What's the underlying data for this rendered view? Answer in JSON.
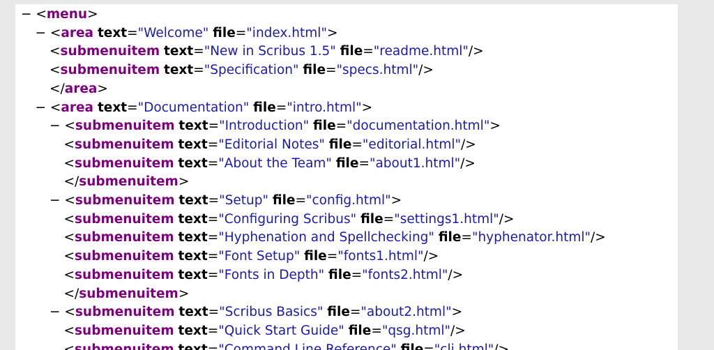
{
  "lines": [
    {
      "indent": 0,
      "toggle": "−",
      "kind": "open",
      "tag": "menu",
      "attrs": []
    },
    {
      "indent": 1,
      "toggle": "−",
      "kind": "open",
      "tag": "area",
      "attrs": [
        {
          "name": "text",
          "value": "Welcome"
        },
        {
          "name": "file",
          "value": "index.html"
        }
      ]
    },
    {
      "indent": 2,
      "toggle": "",
      "kind": "self",
      "tag": "submenuitem",
      "attrs": [
        {
          "name": "text",
          "value": "New in Scribus 1.5"
        },
        {
          "name": "file",
          "value": "readme.html"
        }
      ]
    },
    {
      "indent": 2,
      "toggle": "",
      "kind": "self",
      "tag": "submenuitem",
      "attrs": [
        {
          "name": "text",
          "value": "Specification"
        },
        {
          "name": "file",
          "value": "specs.html"
        }
      ]
    },
    {
      "indent": 2,
      "toggle": "",
      "kind": "close",
      "tag": "area",
      "attrs": []
    },
    {
      "indent": 1,
      "toggle": "−",
      "kind": "open",
      "tag": "area",
      "attrs": [
        {
          "name": "text",
          "value": "Documentation"
        },
        {
          "name": "file",
          "value": "intro.html"
        }
      ]
    },
    {
      "indent": 2,
      "toggle": "−",
      "kind": "open",
      "tag": "submenuitem",
      "attrs": [
        {
          "name": "text",
          "value": "Introduction"
        },
        {
          "name": "file",
          "value": "documentation.html"
        }
      ]
    },
    {
      "indent": 3,
      "toggle": "",
      "kind": "self",
      "tag": "submenuitem",
      "attrs": [
        {
          "name": "text",
          "value": "Editorial Notes"
        },
        {
          "name": "file",
          "value": "editorial.html"
        }
      ]
    },
    {
      "indent": 3,
      "toggle": "",
      "kind": "self",
      "tag": "submenuitem",
      "attrs": [
        {
          "name": "text",
          "value": "About the Team"
        },
        {
          "name": "file",
          "value": "about1.html"
        }
      ]
    },
    {
      "indent": 3,
      "toggle": "",
      "kind": "close",
      "tag": "submenuitem",
      "attrs": []
    },
    {
      "indent": 2,
      "toggle": "−",
      "kind": "open",
      "tag": "submenuitem",
      "attrs": [
        {
          "name": "text",
          "value": "Setup"
        },
        {
          "name": "file",
          "value": "config.html"
        }
      ]
    },
    {
      "indent": 3,
      "toggle": "",
      "kind": "self",
      "tag": "submenuitem",
      "attrs": [
        {
          "name": "text",
          "value": "Configuring Scribus"
        },
        {
          "name": "file",
          "value": "settings1.html"
        }
      ]
    },
    {
      "indent": 3,
      "toggle": "",
      "kind": "self",
      "tag": "submenuitem",
      "attrs": [
        {
          "name": "text",
          "value": "Hyphenation and Spellchecking"
        },
        {
          "name": "file",
          "value": "hyphenator.html"
        }
      ]
    },
    {
      "indent": 3,
      "toggle": "",
      "kind": "self",
      "tag": "submenuitem",
      "attrs": [
        {
          "name": "text",
          "value": "Font Setup"
        },
        {
          "name": "file",
          "value": "fonts1.html"
        }
      ]
    },
    {
      "indent": 3,
      "toggle": "",
      "kind": "self",
      "tag": "submenuitem",
      "attrs": [
        {
          "name": "text",
          "value": "Fonts in Depth"
        },
        {
          "name": "file",
          "value": "fonts2.html"
        }
      ]
    },
    {
      "indent": 3,
      "toggle": "",
      "kind": "close",
      "tag": "submenuitem",
      "attrs": []
    },
    {
      "indent": 2,
      "toggle": "−",
      "kind": "open",
      "tag": "submenuitem",
      "attrs": [
        {
          "name": "text",
          "value": "Scribus Basics"
        },
        {
          "name": "file",
          "value": "about2.html"
        }
      ]
    },
    {
      "indent": 3,
      "toggle": "",
      "kind": "self",
      "tag": "submenuitem",
      "attrs": [
        {
          "name": "text",
          "value": "Quick Start Guide"
        },
        {
          "name": "file",
          "value": "qsg.html"
        }
      ]
    },
    {
      "indent": 3,
      "toggle": "",
      "kind": "self",
      "tag": "submenuitem",
      "attrs": [
        {
          "name": "text",
          "value": "Command Line Reference"
        },
        {
          "name": "file",
          "value": "cli.html"
        }
      ]
    }
  ]
}
